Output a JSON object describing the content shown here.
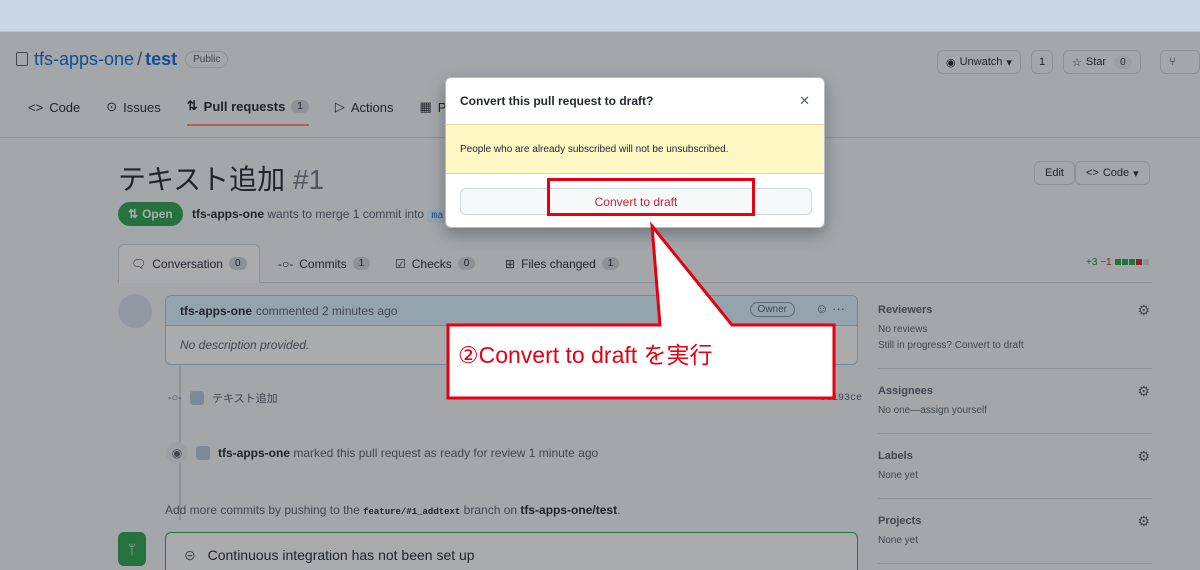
{
  "repo": {
    "owner": "tfs-apps-one",
    "separator": "/",
    "name": "test",
    "visibility": "Public"
  },
  "header_buttons": {
    "watch_label": "Unwatch",
    "watch_count": "1",
    "star_label": "Star",
    "star_count": "0"
  },
  "tabs": [
    {
      "label": "Code",
      "icon": "code-icon"
    },
    {
      "label": "Issues",
      "icon": "issue-icon"
    },
    {
      "label": "Pull requests",
      "count": "1",
      "icon": "pull-request-icon"
    },
    {
      "label": "Actions",
      "icon": "play-icon"
    },
    {
      "label": "Proj",
      "icon": "project-icon"
    }
  ],
  "pr": {
    "title": "テキスト追加",
    "number": "#1",
    "state": "Open",
    "author": "tfs-apps-one",
    "merge_text": "wants to merge 1 commit into",
    "base_branch": "ma",
    "edit_label": "Edit",
    "code_label": "Code"
  },
  "pr_tabs": [
    {
      "label": "Conversation",
      "count": "0"
    },
    {
      "label": "Commits",
      "count": "1"
    },
    {
      "label": "Checks",
      "count": "0"
    },
    {
      "label": "Files changed",
      "count": "1"
    }
  ],
  "diffstat": {
    "additions": "+3",
    "deletions": "−1"
  },
  "comment": {
    "author": "tfs-apps-one",
    "meta": "commented 2 minutes ago",
    "role": "Owner",
    "body": "No description provided."
  },
  "timeline": {
    "commit_message": "テキスト追加",
    "commit_sha": "bd193ce",
    "ready_author": "tfs-apps-one",
    "ready_text": "marked this pull request as ready for review 1 minute ago"
  },
  "hint": {
    "prefix": "Add more commits by pushing to the",
    "branch": "feature/#1_addtext",
    "middle": "branch on",
    "repo": "tfs-apps-one/test",
    "suffix": "."
  },
  "ci": {
    "text": "Continuous integration has not been set up"
  },
  "sidebar": {
    "reviewers": {
      "title": "Reviewers",
      "line1": "No reviews",
      "line2": "Still in progress? Convert to draft"
    },
    "assignees": {
      "title": "Assignees",
      "line1": "No one—assign yourself"
    },
    "labels": {
      "title": "Labels",
      "line1": "None yet"
    },
    "projects": {
      "title": "Projects",
      "line1": "None yet"
    }
  },
  "modal": {
    "title": "Convert this pull request to draft?",
    "warning": "People who are already subscribed will not be unsubscribed.",
    "button": "Convert to draft"
  },
  "annotation": {
    "text": "②Convert to draft を実行",
    "color": "#e60012"
  }
}
